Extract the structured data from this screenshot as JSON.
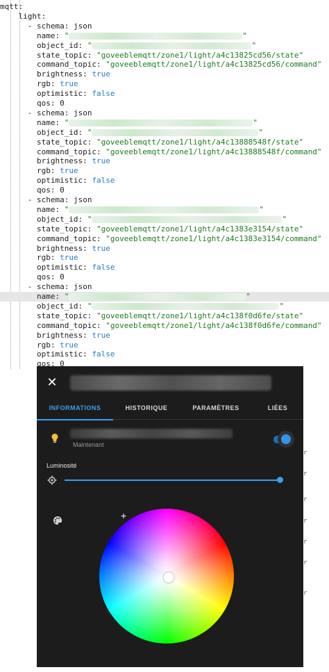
{
  "code": {
    "lines": [
      {
        "indent": 0,
        "key": "mqtt:"
      },
      {
        "indent": 1,
        "key": "light:"
      },
      {
        "indent": 2,
        "dash": true,
        "key": "schema: ",
        "val": "json",
        "vtype": "plain"
      },
      {
        "indent": 3,
        "key": "name: ",
        "val": "\"",
        "vtype": "str",
        "blur": 250
      },
      {
        "indent": 3,
        "key": "object_id: ",
        "val": "\"",
        "vtype": "str",
        "blur": 230
      },
      {
        "indent": 3,
        "key": "state_topic: ",
        "val": "\"goveeblemqtt/zone1/light/a4c13825cd56/state\"",
        "vtype": "str"
      },
      {
        "indent": 3,
        "key": "command_topic: ",
        "val": "\"goveeblemqtt/zone1/light/a4c13825cd56/command\"",
        "vtype": "str"
      },
      {
        "indent": 3,
        "key": "brightness: ",
        "val": "true",
        "vtype": "kw"
      },
      {
        "indent": 3,
        "key": "rgb: ",
        "val": "true",
        "vtype": "kw"
      },
      {
        "indent": 3,
        "key": "optimistic: ",
        "val": "false",
        "vtype": "kw"
      },
      {
        "indent": 3,
        "key": "qos: ",
        "val": "0",
        "vtype": "plain"
      },
      {
        "indent": 2,
        "dash": true,
        "key": "schema: ",
        "val": "json",
        "vtype": "plain"
      },
      {
        "indent": 3,
        "key": "name: ",
        "val": "\"",
        "vtype": "str",
        "blur": 265
      },
      {
        "indent": 3,
        "key": "object_id: ",
        "val": "\"",
        "vtype": "str",
        "blur": 240
      },
      {
        "indent": 3,
        "key": "state_topic: ",
        "val": "\"goveeblemqtt/zone1/light/a4c13888548f/state\"",
        "vtype": "str"
      },
      {
        "indent": 3,
        "key": "command_topic: ",
        "val": "\"goveeblemqtt/zone1/light/a4c13888548f/command\"",
        "vtype": "str"
      },
      {
        "indent": 3,
        "key": "brightness: ",
        "val": "true",
        "vtype": "kw"
      },
      {
        "indent": 3,
        "key": "rgb: ",
        "val": "true",
        "vtype": "kw"
      },
      {
        "indent": 3,
        "key": "optimistic: ",
        "val": "false",
        "vtype": "kw"
      },
      {
        "indent": 3,
        "key": "qos: ",
        "val": "0",
        "vtype": "plain"
      },
      {
        "indent": 2,
        "dash": true,
        "key": "schema: ",
        "val": "json",
        "vtype": "plain"
      },
      {
        "indent": 3,
        "key": "name: ",
        "val": "\"",
        "vtype": "str",
        "blur": 285
      },
      {
        "indent": 3,
        "key": "object_id: ",
        "val": "\"",
        "vtype": "str",
        "blur": 280
      },
      {
        "indent": 3,
        "key": "state_topic: ",
        "val": "\"goveeblemqtt/zone1/light/a4c1383e3154/state\"",
        "vtype": "str"
      },
      {
        "indent": 3,
        "key": "command_topic: ",
        "val": "\"goveeblemqtt/zone1/light/a4c1383e3154/command\"",
        "vtype": "str"
      },
      {
        "indent": 3,
        "key": "brightness: ",
        "val": "true",
        "vtype": "kw"
      },
      {
        "indent": 3,
        "key": "rgb: ",
        "val": "true",
        "vtype": "kw"
      },
      {
        "indent": 3,
        "key": "optimistic: ",
        "val": "false",
        "vtype": "kw"
      },
      {
        "indent": 3,
        "key": "qos: ",
        "val": "0",
        "vtype": "plain"
      },
      {
        "indent": 2,
        "dash": true,
        "key": "schema: ",
        "val": "json",
        "vtype": "plain"
      },
      {
        "indent": 3,
        "key": "name: ",
        "val": "\"",
        "vtype": "str",
        "blur": 255,
        "hl": true
      },
      {
        "indent": 3,
        "key": "object_id: ",
        "val": "\"",
        "vtype": "str",
        "blur": 270
      },
      {
        "indent": 3,
        "key": "state_topic: ",
        "val": "\"goveeblemqtt/zone1/light/a4c138f0d6fe/state\"",
        "vtype": "str"
      },
      {
        "indent": 3,
        "key": "command_topic: ",
        "val": "\"goveeblemqtt/zone1/light/a4c138f0d6fe/command\"",
        "vtype": "str"
      },
      {
        "indent": 3,
        "key": "brightness: ",
        "val": "true",
        "vtype": "kw"
      },
      {
        "indent": 3,
        "key": "rgb: ",
        "val": "true",
        "vtype": "kw"
      },
      {
        "indent": 3,
        "key": "optimistic: ",
        "val": "false",
        "vtype": "kw"
      },
      {
        "indent": 3,
        "key": "qos: ",
        "val": "0",
        "vtype": "plain"
      }
    ]
  },
  "dialog": {
    "tabs": [
      {
        "label": "INFORMATIONS",
        "active": true
      },
      {
        "label": "HISTORIQUE",
        "active": false
      },
      {
        "label": "PARAMÈTRES",
        "active": false
      },
      {
        "label": "LIÉES",
        "active": false
      }
    ],
    "entity_subtext": "Maintenant",
    "brightness_label": "Luminosité",
    "brightness_percent": 100,
    "toggle_on": true,
    "accent_color": "#3aa0ef"
  }
}
